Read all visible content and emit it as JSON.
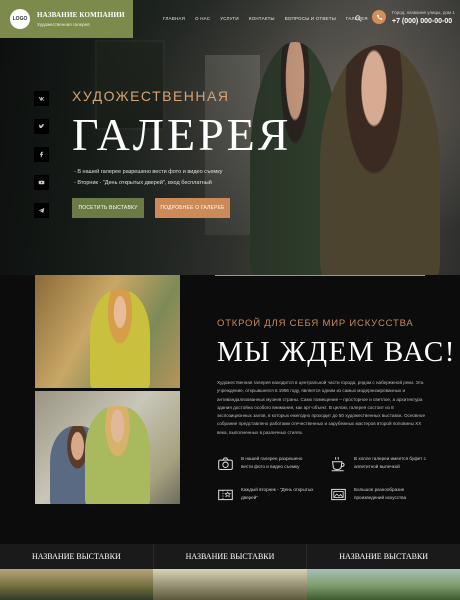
{
  "header": {
    "logo": "LOGO",
    "company": "НАЗВАНИЕ КОМПАНИИ",
    "slogan": "Художественная галерея",
    "nav": [
      "Главная",
      "О нас",
      "Услуги",
      "Контакты",
      "Вопросы и ответы",
      "Галерея"
    ],
    "address": "Город, название улицы, дом 1",
    "phone": "+7 (000) 000-00-00"
  },
  "hero": {
    "subtitle": "ХУДОЖЕСТВЕННАЯ",
    "title": "ГАЛЕРЕЯ",
    "bullets": [
      "- В нашей галерее разрешено вести фото и видео съемку",
      "- Вторник - \"День открытых дверей\", вход бесплатный"
    ],
    "btn_primary": "Посетить выставку",
    "btn_secondary": "Подробнее о галерее",
    "socials": [
      "vk-icon",
      "twitter-icon",
      "facebook-icon",
      "youtube-icon",
      "telegram-icon"
    ]
  },
  "about": {
    "subtitle": "ОТКРОЙ ДЛЯ СЕБЯ МИР ИСКУССТВА",
    "title": "МЫ ЖДЕМ ВАС!",
    "paragraph": "Художественная галерея находится в центральной части города, рядом с набережной реки. Эта учреждение, открывшееся в 1996 году, является одним из самых модернизированных и антивандализованных музеев страны. Само помещение – просторное и светлое, а архитектура здания достойна особого внимания, как арт-объект. В целом, галерея состоит из 8 экспозиционных залов, в которых ежегодно проходит до 50 художественных выставок. Основное собрание представлено работами отечественных и зарубежных мастеров второй половины XX века, выполненных в различных стилях.",
    "features": [
      {
        "icon": "camera-icon",
        "text": "В нашей галерее разрешено вести фото и видео съемку"
      },
      {
        "icon": "coffee-icon",
        "text": "В холле галереи имеется буфет с аппетитной выпечкой"
      },
      {
        "icon": "ticket-icon",
        "text": "Каждый вторник - \"День открытых дверей\""
      },
      {
        "icon": "gallery-icon",
        "text": "Большое разнообразие произведений искусства"
      }
    ]
  },
  "exhibitions": [
    "НАЗВАНИЕ ВЫСТАВКИ",
    "НАЗВАНИЕ ВЫСТАВКИ",
    "НАЗВАНИЕ ВЫСТАВКИ"
  ],
  "colors": {
    "accent": "#c98a58",
    "brand": "#7c8a4c",
    "button_green": "#6b7b45",
    "button_orange": "#cc8a57"
  }
}
